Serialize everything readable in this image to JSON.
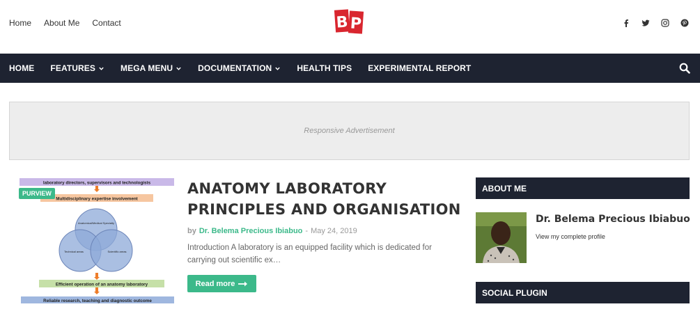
{
  "top_links": [
    "Home",
    "About Me",
    "Contact"
  ],
  "logo": {
    "text": "BP",
    "color": "#d9262f"
  },
  "social_icons": [
    "facebook-icon",
    "twitter-icon",
    "instagram-icon",
    "pinterest-icon"
  ],
  "nav": {
    "items": [
      {
        "label": "HOME",
        "dropdown": false
      },
      {
        "label": "FEATURES",
        "dropdown": true
      },
      {
        "label": "MEGA MENU",
        "dropdown": true
      },
      {
        "label": "DOCUMENTATION",
        "dropdown": true
      },
      {
        "label": "HEALTH TIPS",
        "dropdown": false
      },
      {
        "label": "EXPERIMENTAL REPORT",
        "dropdown": false
      }
    ],
    "bg_color": "#1e2331"
  },
  "ad": {
    "text": "Responsive Advertisement"
  },
  "post": {
    "badge": "PURVIEW",
    "title": "ANATOMY LABORATORY PRINCIPLES AND ORGANISATION",
    "by": "by",
    "author": "Dr. Belema Precious Ibiabuo",
    "separator": "-",
    "date": "May 24, 2019",
    "excerpt": "Introduction A laboratory is an equipped facility which is dedicated for carrying out scientific ex…",
    "read_more": "Read more",
    "accent_color": "#3cb98a",
    "diagram": {
      "boxes": [
        "laboratory directors, supervisors and technologists",
        "Multidisciplinary expertise involvement",
        "Efficient operation of an anatomy laboratory",
        "Reliable research, teaching and diagnostic outcome"
      ],
      "circles": [
        "Anatomical/Medical Specialty",
        "Technical areas",
        "Scientific areas"
      ]
    }
  },
  "sidebar": {
    "about_title": "ABOUT ME",
    "profile_name": "Dr. Belema Precious Ibiabuo",
    "profile_link": "View my complete profile",
    "social_title": "SOCIAL PLUGIN"
  }
}
